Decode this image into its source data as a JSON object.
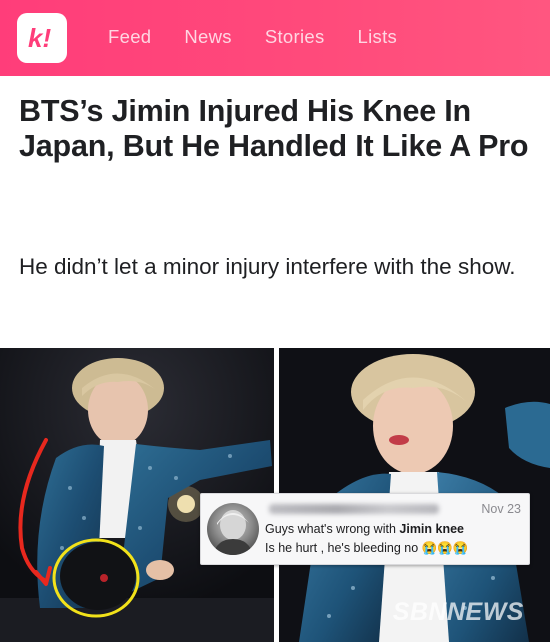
{
  "header": {
    "logo_text": "k!",
    "nav": [
      "Feed",
      "News",
      "Stories",
      "Lists"
    ]
  },
  "article": {
    "title": "BTS’s Jimin Injured His Knee In Japan, But He Handled It Like A Pro",
    "subtitle": "He didn’t let a minor injury interfere with the show."
  },
  "comment": {
    "date": "Nov 23",
    "line1_prefix": "Guys what's wrong with ",
    "line1_bold": "Jimin knee",
    "line2": "Is he hurt , he's bleeding no 😭😭😭"
  },
  "watermark": "SBNNEWS",
  "colors": {
    "brand_pink": "#ff4b7b",
    "annotation_red": "#e8281e",
    "annotation_yellow": "#f2e21a"
  }
}
